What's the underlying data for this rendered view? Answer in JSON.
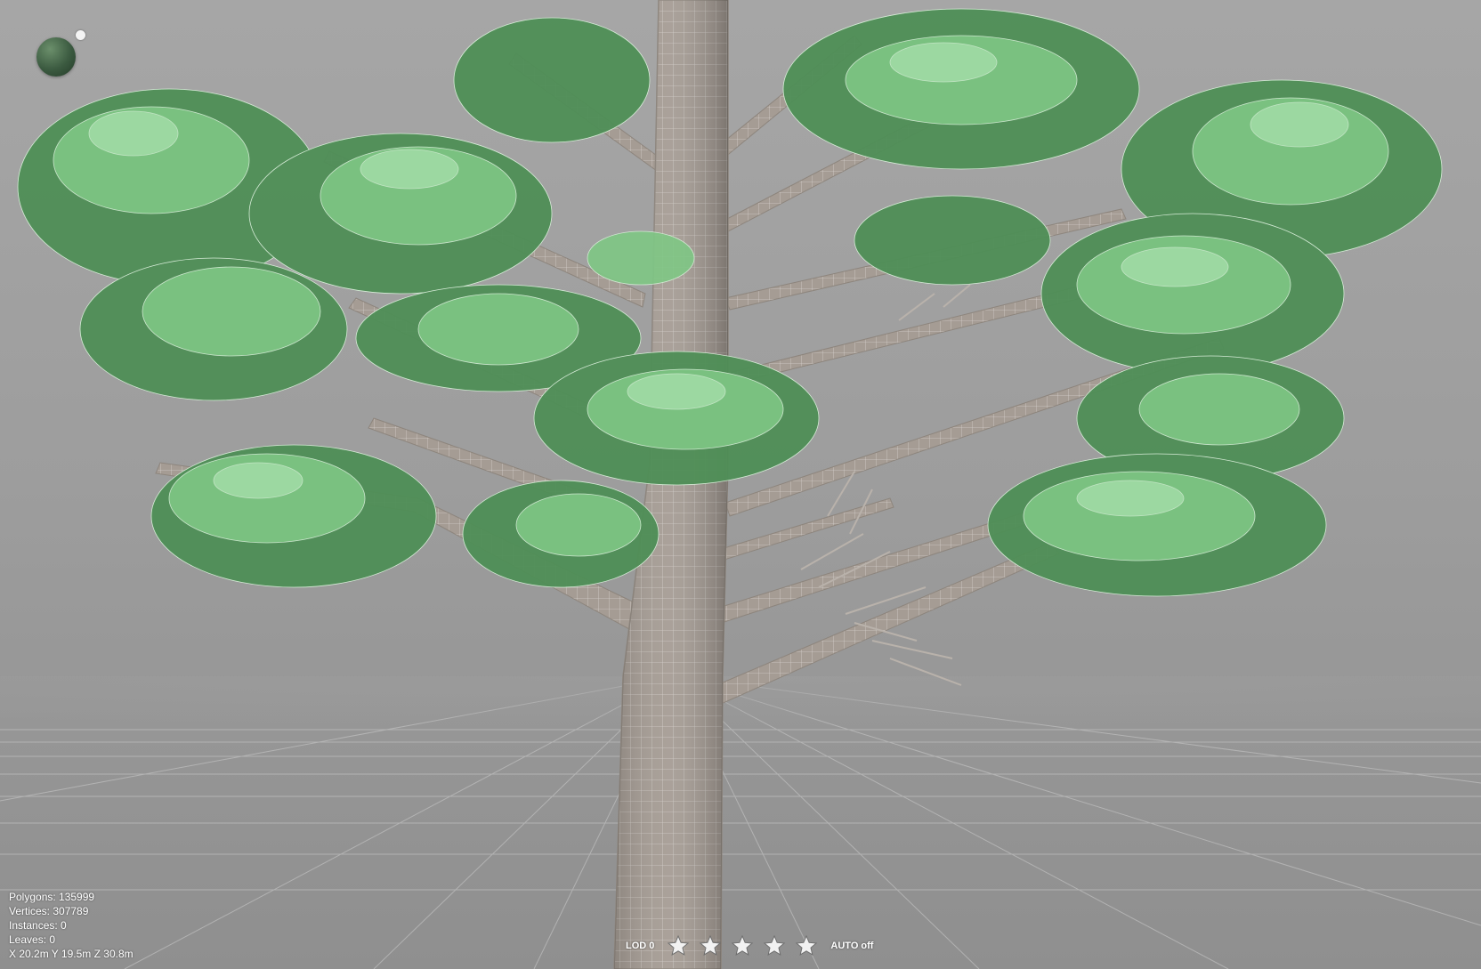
{
  "stats": {
    "polygons": "Polygons: 135999",
    "vertices": "Vertices: 307789",
    "instances": "Instances: 0",
    "leaves": "Leaves: 0",
    "position": "X 20.2m Y 19.5m Z 30.8m"
  },
  "lod": {
    "label": "LOD 0",
    "stars": [
      "star-icon",
      "star-icon",
      "star-icon",
      "star-icon",
      "star-icon"
    ],
    "auto_label": "AUTO off"
  },
  "icons": {
    "light_orb": "light-sphere-icon",
    "light_dot": "light-direction-icon"
  },
  "colors": {
    "background": "#a0a0a0",
    "leaf": "#7fc785",
    "leaf_dark": "#4f8f57",
    "bark": "#a39a92",
    "text": "#ffffff"
  }
}
